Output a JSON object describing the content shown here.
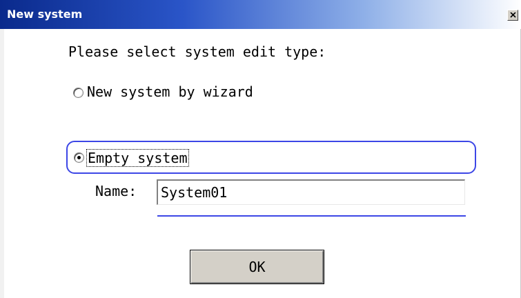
{
  "window": {
    "title": "New system"
  },
  "dialog": {
    "prompt": "Please select system edit type:",
    "options": [
      {
        "label": "New system by wizard",
        "selected": false
      },
      {
        "label": "Empty system",
        "selected": true
      }
    ],
    "name_label": "Name:",
    "name_value": "System01",
    "ok_label": "OK"
  },
  "colors": {
    "titlebar_start": "#0a2a8c",
    "group_border": "#3c46e6",
    "button_face": "#d4d0c8"
  }
}
